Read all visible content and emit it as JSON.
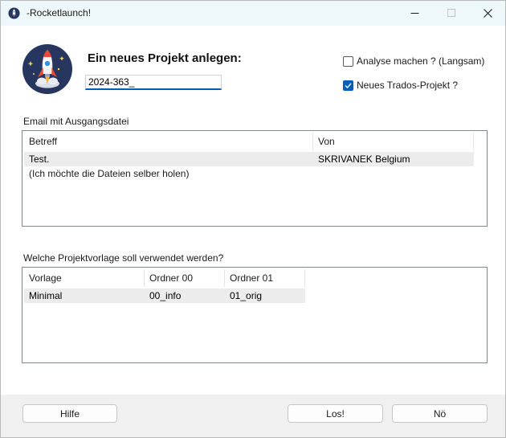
{
  "window": {
    "title": "-Rocketlaunch!"
  },
  "header": {
    "heading": "Ein neues Projekt anlegen:",
    "project_input_value": "2024-363_"
  },
  "options": {
    "analyse_label": "Analyse machen ? (Langsam)",
    "analyse_checked": false,
    "trados_label": "Neues Trados-Projekt ?",
    "trados_checked": true
  },
  "email_section": {
    "label": "Email mit Ausgangsdatei",
    "columns": [
      "Betreff",
      "Von"
    ],
    "rows": [
      {
        "betreff": "Test.",
        "von": "SKRIVANEK Belgium"
      }
    ],
    "extra_line": "(Ich möchte die Dateien selber holen)"
  },
  "template_section": {
    "label": "Welche Projektvorlage soll verwendet werden?",
    "columns": [
      "Vorlage",
      "Ordner 00",
      "Ordner 01"
    ],
    "rows": [
      {
        "vorlage": "Minimal",
        "ordner00": "00_info",
        "ordner01": "01_orig"
      }
    ]
  },
  "buttons": {
    "help": "Hilfe",
    "go": "Los!",
    "no": "Nö"
  },
  "colors": {
    "accent": "#005fb8",
    "titlebar": "#eef7f9",
    "logo_bg": "#27365f"
  }
}
